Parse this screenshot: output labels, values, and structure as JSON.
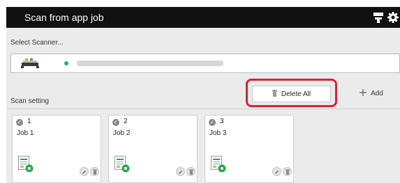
{
  "window": {
    "title": "Scan from app job"
  },
  "icons": {
    "titlebar": [
      "scanner-config-icon",
      "gear-icon"
    ],
    "scanner": "scanner-icon",
    "job_document": "scan-document-icon",
    "edit": "pencil-icon",
    "delete": "trash-icon",
    "add": "plus-icon",
    "number_badge": "number-badge-icon"
  },
  "scanner_select": {
    "label": "Select Scanner..."
  },
  "scan_setting": {
    "label": "Scan setting",
    "delete_all_label": "Delete All",
    "add_label": "Add"
  },
  "jobs": [
    {
      "number": "1",
      "name": "Job 1"
    },
    {
      "number": "2",
      "name": "Job 2"
    },
    {
      "number": "3",
      "name": "Job 3"
    }
  ],
  "colors": {
    "titlebar": "#111111",
    "background": "#ebebeb",
    "highlight": "#d7262e",
    "status": "#21b36b"
  }
}
